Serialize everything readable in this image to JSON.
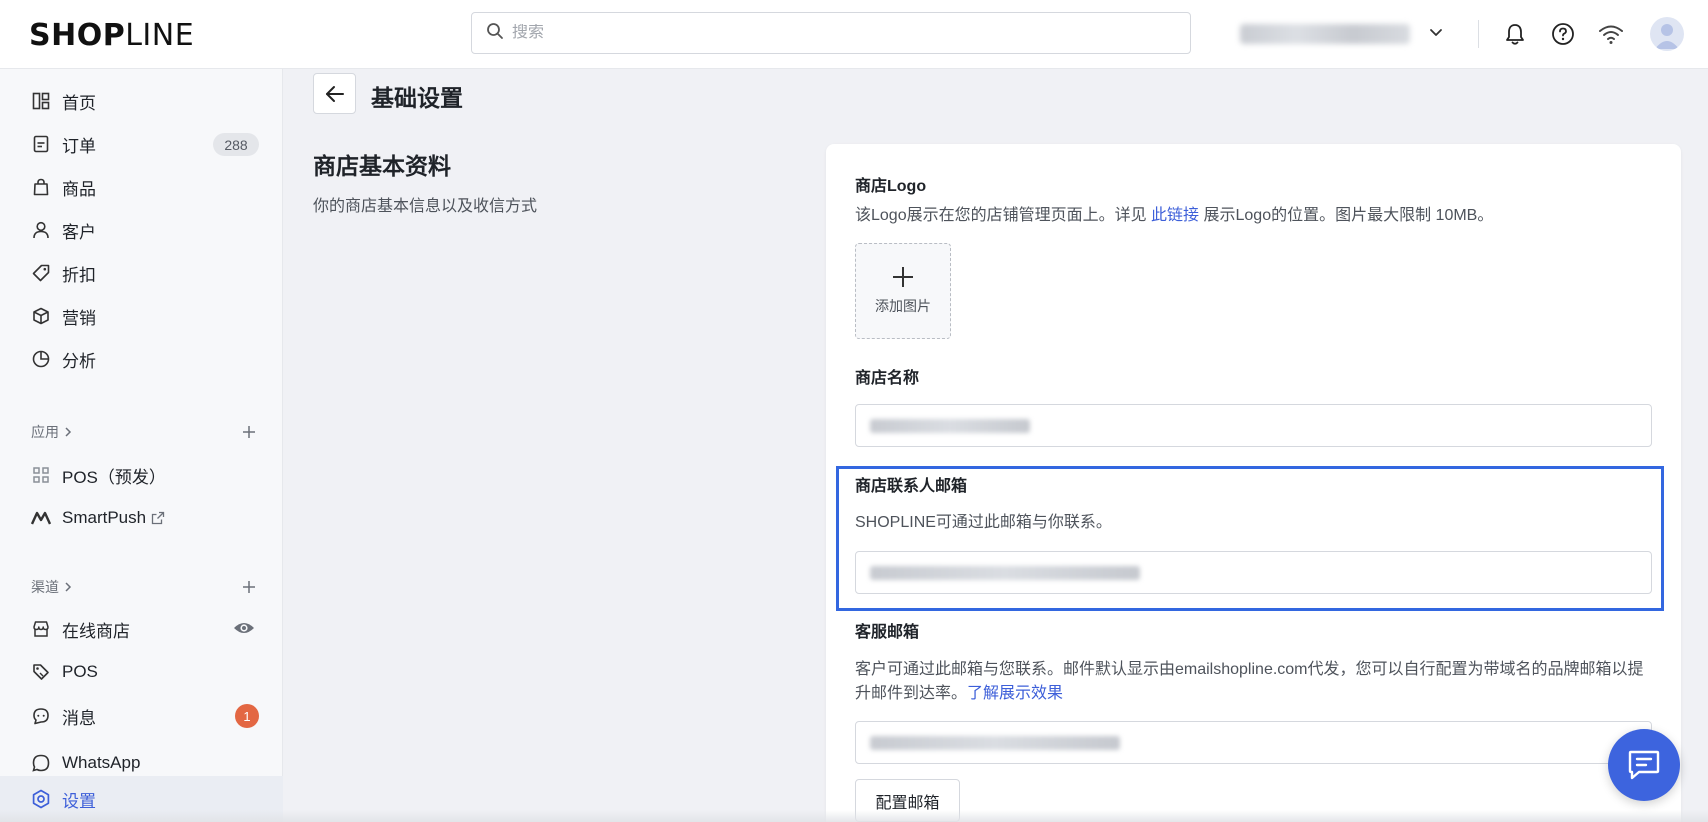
{
  "topbar": {
    "logo_bold": "SHOP",
    "logo_light": "LINE",
    "search_placeholder": "搜索"
  },
  "sidebar": {
    "items": [
      {
        "label": "首页",
        "icon": "dashboard-icon"
      },
      {
        "label": "订单",
        "icon": "order-icon",
        "badge": "288"
      },
      {
        "label": "商品",
        "icon": "bag-icon"
      },
      {
        "label": "客户",
        "icon": "person-icon"
      },
      {
        "label": "折扣",
        "icon": "tag-icon"
      },
      {
        "label": "营销",
        "icon": "cube-icon"
      },
      {
        "label": "分析",
        "icon": "pie-chart-icon"
      }
    ],
    "apps_section": {
      "label": "应用",
      "items": [
        {
          "label": "POS（预发）",
          "icon": "apps-grid-icon"
        },
        {
          "label": "SmartPush",
          "icon": "smartpush-icon"
        }
      ]
    },
    "channels_section": {
      "label": "渠道",
      "items": [
        {
          "label": "在线商店",
          "icon": "store-icon"
        },
        {
          "label": "POS",
          "icon": "pos-tag-icon"
        },
        {
          "label": "消息",
          "icon": "message-icon",
          "badge": "1"
        },
        {
          "label": "WhatsApp",
          "icon": "whatsapp-icon"
        }
      ]
    },
    "settings": {
      "label": "设置",
      "icon": "settings-icon"
    }
  },
  "page": {
    "title": "基础设置",
    "section_title": "商店基本资料",
    "section_desc": "你的商店基本信息以及收信方式"
  },
  "card": {
    "logo_label": "商店Logo",
    "logo_desc_prefix": "该Logo展示在您的店铺管理页面上。详见 ",
    "logo_desc_link": "此链接",
    "logo_desc_suffix": " 展示Logo的位置。图片最大限制 10MB。",
    "upload_label": "添加图片",
    "store_name_label": "商店名称",
    "contact_email_label": "商店联系人邮箱",
    "contact_email_desc": "SHOPLINE可通过此邮箱与你联系。",
    "service_email_label": "客服邮箱",
    "service_email_desc": "客户可通过此邮箱与您联系。邮件默认显示由emailshopline.com代发，您可以自行配置为带域名的品牌邮箱以提升邮件到达率。",
    "service_email_link": "了解展示效果",
    "config_button": "配置邮箱"
  },
  "colors": {
    "accent": "#3d5fd9",
    "highlight_border": "#3367e0",
    "badge_red": "#e36743",
    "fab": "#3d64de"
  }
}
